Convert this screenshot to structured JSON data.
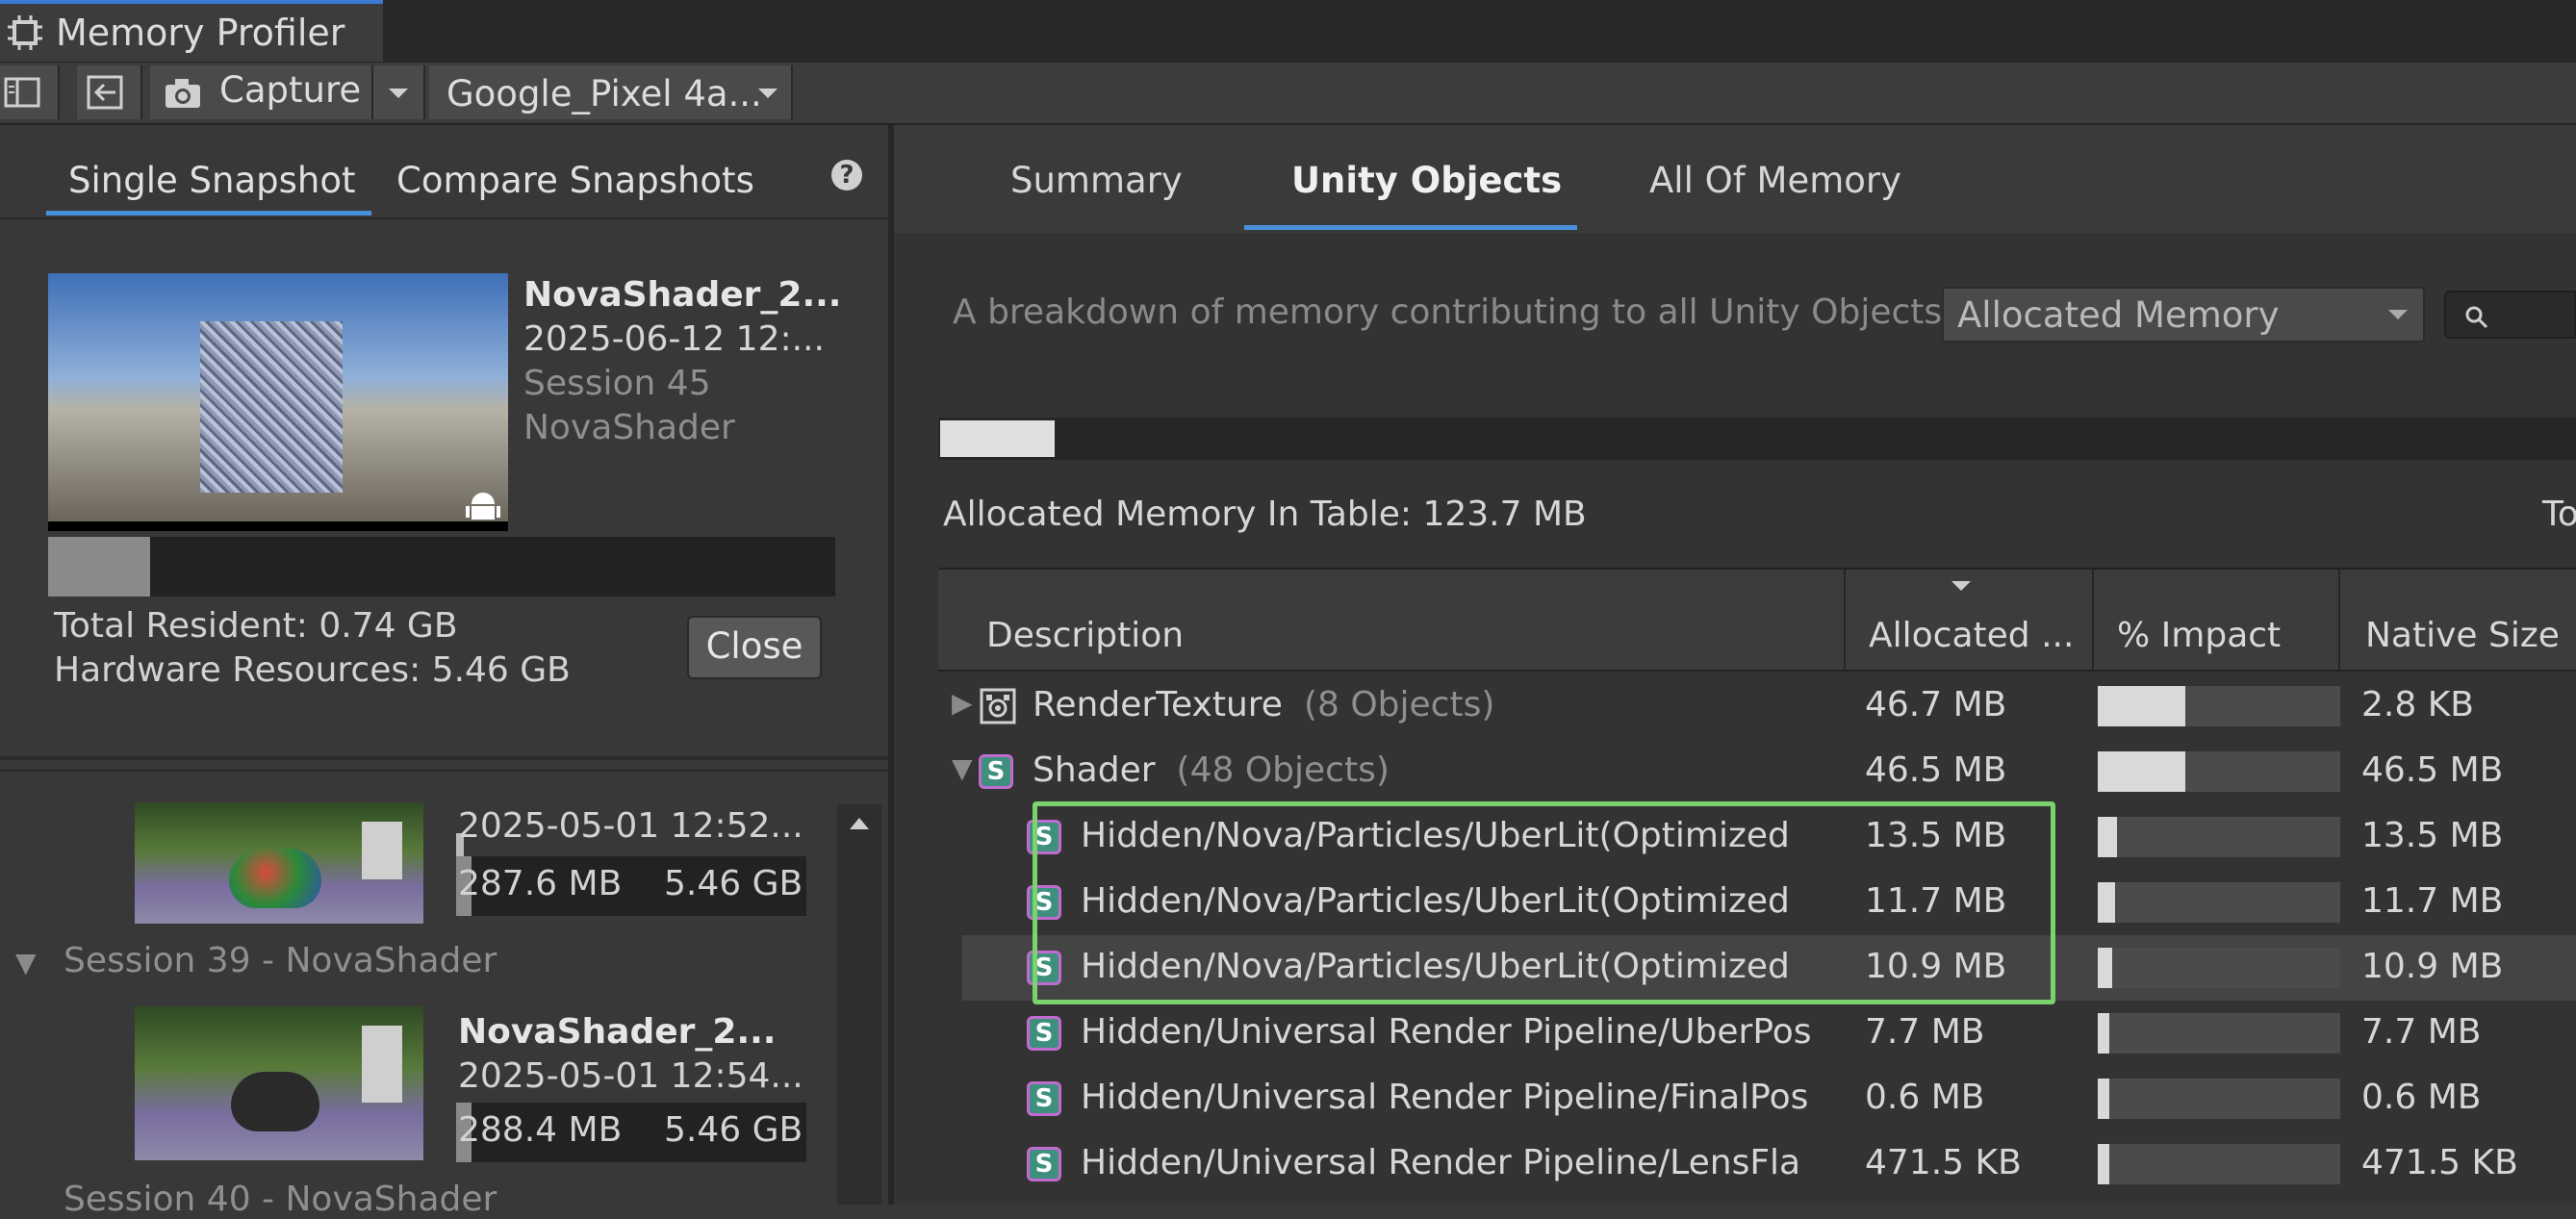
{
  "window": {
    "title": "Memory Profiler"
  },
  "toolbar": {
    "capture_label": "Capture",
    "target_device": "Google_Pixel 4a..."
  },
  "left": {
    "tabs": [
      {
        "label": "Single Snapshot",
        "active": true
      },
      {
        "label": "Compare Snapshots",
        "active": false
      }
    ],
    "help_glyph": "?",
    "current": {
      "name": "NovaShader_2...",
      "date": "2025-06-12 12:...",
      "session": "Session 45",
      "project": "NovaShader",
      "resident_fraction": 0.13,
      "total_resident": "Total Resident: 0.74 GB",
      "hardware_resources": "Hardware Resources: 5.46 GB",
      "close_label": "Close"
    },
    "list": {
      "top_item": {
        "date": "2025-05-01 12:52...",
        "size": "287.6 MB",
        "total": "5.46 GB"
      },
      "session39_title": "Session 39 - NovaShader",
      "session39_item": {
        "name": "NovaShader_2...",
        "date": "2025-05-01 12:54...",
        "size": "288.4 MB",
        "total": "5.46 GB"
      },
      "session40_title": "Session 40 - NovaShader"
    }
  },
  "right": {
    "tabs": [
      {
        "label": "Summary",
        "active": false
      },
      {
        "label": "Unity Objects",
        "active": true
      },
      {
        "label": "All Of Memory",
        "active": false
      }
    ],
    "description": "A breakdown of memory contributing to all Unity Objects.",
    "mode_dropdown": "Allocated Memory",
    "overview_fraction": 0.07,
    "allocated_in_table": "Allocated Memory In Table: 123.7 MB",
    "right_clip": "To",
    "columns": {
      "description": "Description",
      "allocated": "Allocated ...",
      "impact": "% Impact",
      "native": "Native Size"
    },
    "rows": [
      {
        "expander": "▶",
        "icon": "render-texture-icon",
        "name": "RenderTexture",
        "count": "(8 Objects)",
        "allocated": "46.7 MB",
        "impact": 0.36,
        "native": "2.8 KB",
        "level": 0
      },
      {
        "expander": "▼",
        "icon": "shader-icon",
        "name": "Shader",
        "count": "(48 Objects)",
        "allocated": "46.5 MB",
        "impact": 0.36,
        "native": "46.5 MB",
        "level": 0
      },
      {
        "icon": "shader-icon",
        "name": "Hidden/Nova/Particles/UberLit(Optimized",
        "allocated": "13.5 MB",
        "impact": 0.08,
        "native": "13.5 MB",
        "level": 1
      },
      {
        "icon": "shader-icon",
        "name": "Hidden/Nova/Particles/UberLit(Optimized",
        "allocated": "11.7 MB",
        "impact": 0.07,
        "native": "11.7 MB",
        "level": 1
      },
      {
        "icon": "shader-icon",
        "name": "Hidden/Nova/Particles/UberLit(Optimized",
        "allocated": "10.9 MB",
        "impact": 0.06,
        "native": "10.9 MB",
        "level": 1,
        "selected": true
      },
      {
        "icon": "shader-icon",
        "name": "Hidden/Universal Render Pipeline/UberPos",
        "allocated": "7.7 MB",
        "impact": 0.04,
        "native": "7.7 MB",
        "level": 1
      },
      {
        "icon": "shader-icon",
        "name": "Hidden/Universal Render Pipeline/FinalPos",
        "allocated": "0.6 MB",
        "impact": 0.03,
        "native": "0.6 MB",
        "level": 1
      },
      {
        "icon": "shader-icon",
        "name": "Hidden/Universal Render Pipeline/LensFla",
        "allocated": "471.5 KB",
        "impact": 0.03,
        "native": "471.5 KB",
        "level": 1
      }
    ],
    "shader_icon_letter": "S",
    "highlight_color": "#7ad36d"
  },
  "colors": {
    "accent": "#4a90d9",
    "panel": "#383838",
    "table_bg": "#333333"
  }
}
